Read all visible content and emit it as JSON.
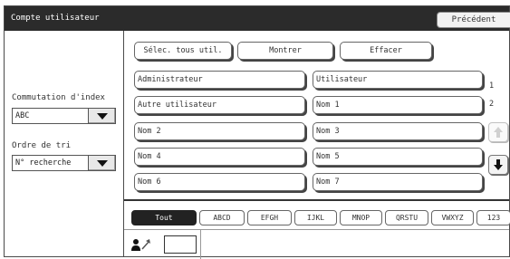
{
  "window": {
    "title": "Compte utilisateur",
    "back_label": "Précédent"
  },
  "sidebar": {
    "index_switch_label": "Commutation d'index",
    "index_switch_value": "ABC",
    "sort_order_label": "Ordre de tri",
    "sort_order_value": "N° recherche"
  },
  "actions": {
    "select_all": "Sélec. tous util.",
    "show": "Montrer",
    "clear": "Effacer"
  },
  "users": [
    "Administrateur",
    "Utilisateur",
    "Autre utilisateur",
    "Nom 1",
    "Nom 2",
    "Nom 3",
    "Nom 4",
    "Nom 5",
    "Nom 6",
    "Nom 7"
  ],
  "pager": {
    "current": "1",
    "total": "2"
  },
  "index_tabs": [
    "Tout",
    "ABCD",
    "EFGH",
    "IJKL",
    "MNOP",
    "QRSTU",
    "VWXYZ",
    "123"
  ],
  "active_tab": "Tout",
  "colors": {
    "title_bar": "#2b2b2b",
    "active_tab": "#222222"
  }
}
